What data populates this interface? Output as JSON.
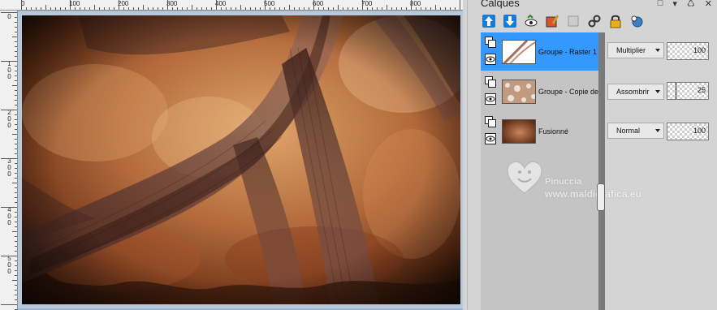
{
  "ruler": {
    "top_labels": [
      "0",
      "100",
      "200",
      "300",
      "400",
      "500",
      "600",
      "700",
      "800"
    ],
    "left_labels": [
      "0",
      "1\n0\n0",
      "2\n0\n0",
      "3\n0\n0",
      "4\n0\n0",
      "5\n0\n0"
    ]
  },
  "panel": {
    "title": "Calques"
  },
  "toolbar": {
    "icons": [
      "move-up-icon",
      "move-down-icon",
      "visibility-toggle-icon",
      "edit-layer-icon",
      "delete-layer-icon",
      "link-icon",
      "lock-icon",
      "mask-icon"
    ]
  },
  "layers": [
    {
      "name": "Groupe - Raster 1",
      "blend": "Multiplier",
      "opacity": "100",
      "selected": true
    },
    {
      "name": "Groupe - Copie de F",
      "blend": "Assombrir",
      "opacity": "25",
      "selected": false
    },
    {
      "name": "Fusionné",
      "blend": "Normal",
      "opacity": "100",
      "selected": false
    }
  ],
  "watermark": {
    "name": "Pinuccia",
    "url": "www.maldigrafica.eu"
  },
  "colors": {
    "selected_row": "#3399ff",
    "panel_bg": "#d4d4d4",
    "list_bg": "#c4c4c4"
  }
}
